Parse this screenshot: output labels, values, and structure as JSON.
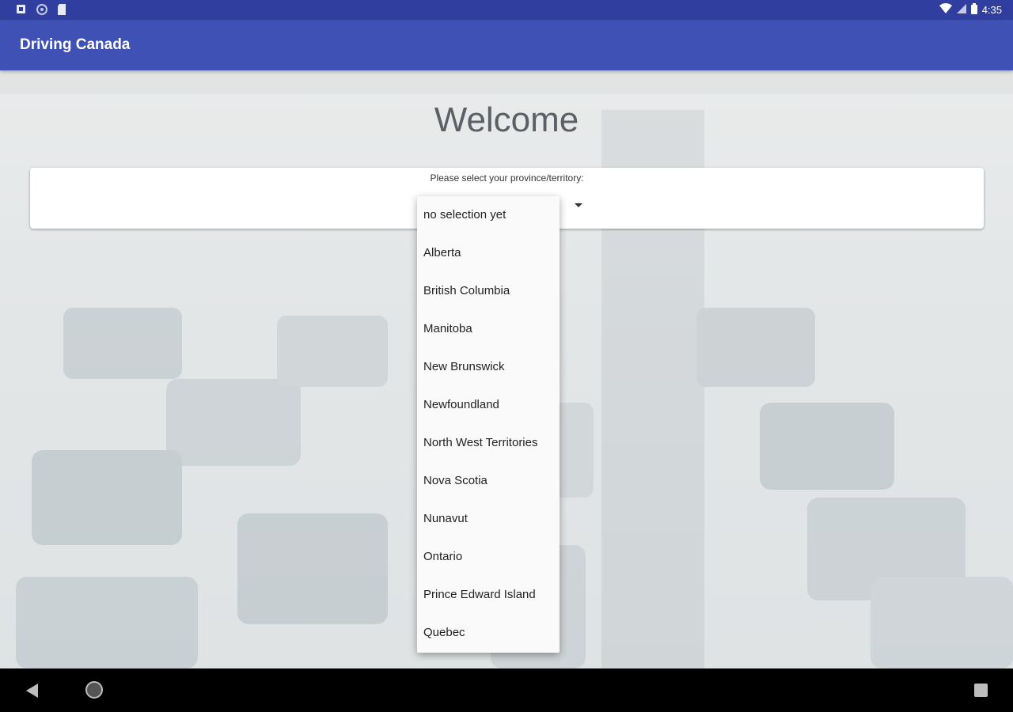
{
  "status_bar": {
    "time": "4:35",
    "left_icons": [
      "notification-icon",
      "sync-icon",
      "sd-card-icon"
    ],
    "right_icons": [
      "wifi-icon",
      "signal-icon",
      "battery-icon"
    ]
  },
  "app_bar": {
    "title": "Driving Canada"
  },
  "main": {
    "heading": "Welcome",
    "province_select": {
      "label": "Please select your province/territory:",
      "options": [
        "no selection yet",
        "Alberta",
        "British Columbia",
        "Manitoba",
        "New Brunswick",
        "Newfoundland",
        "North West Territories",
        "Nova Scotia",
        "Nunavut",
        "Ontario",
        "Prince Edward Island",
        "Quebec"
      ]
    }
  },
  "nav_bar": {
    "icons": [
      "back-icon",
      "home-icon",
      "recents-icon"
    ]
  },
  "colors": {
    "status_bar": "#303f9f",
    "app_bar": "#3f51b5"
  }
}
